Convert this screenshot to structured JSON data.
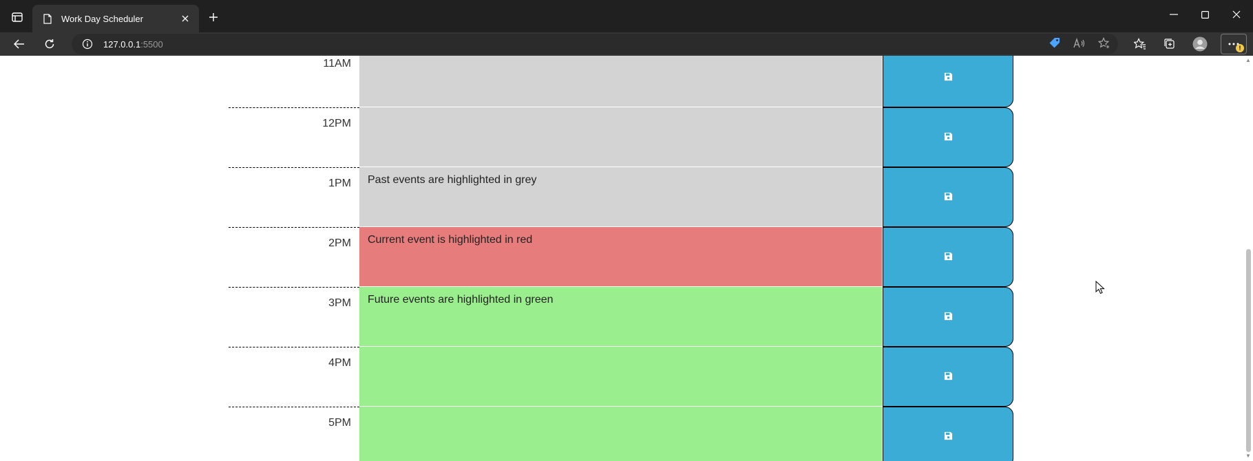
{
  "browser": {
    "tab_title": "Work Day Scheduler",
    "url_host": "127.0.0.1",
    "url_port": ":5500",
    "notification_badge": "!"
  },
  "icons": {
    "tab_actions": "tab-actions-icon",
    "page": "page-icon",
    "close_tab": "close-icon",
    "new_tab": "plus-icon",
    "minimize": "minimize-icon",
    "maximize": "maximize-icon",
    "close_window": "close-icon",
    "back": "back-arrow-icon",
    "refresh": "refresh-icon",
    "site_info": "info-icon",
    "coupon": "tag-icon",
    "read_aloud": "read-aloud-icon",
    "favorite": "star-plus-icon",
    "favorites": "favorites-icon",
    "collections": "collections-icon",
    "profile": "profile-icon",
    "more": "more-icon",
    "save": "floppy-disk-icon"
  },
  "colors": {
    "past": "#d3d3d3",
    "present": "#e77c7c",
    "future": "#9bee8d",
    "save_button": "#3aacd6"
  },
  "schedule": [
    {
      "hour": "11AM",
      "status": "past",
      "text": ""
    },
    {
      "hour": "12PM",
      "status": "past",
      "text": ""
    },
    {
      "hour": "1PM",
      "status": "past",
      "text": "Past events are highlighted in grey"
    },
    {
      "hour": "2PM",
      "status": "present",
      "text": "Current event is highlighted in red"
    },
    {
      "hour": "3PM",
      "status": "future",
      "text": "Future events are highlighted in green"
    },
    {
      "hour": "4PM",
      "status": "future",
      "text": ""
    },
    {
      "hour": "5PM",
      "status": "future",
      "text": ""
    }
  ]
}
